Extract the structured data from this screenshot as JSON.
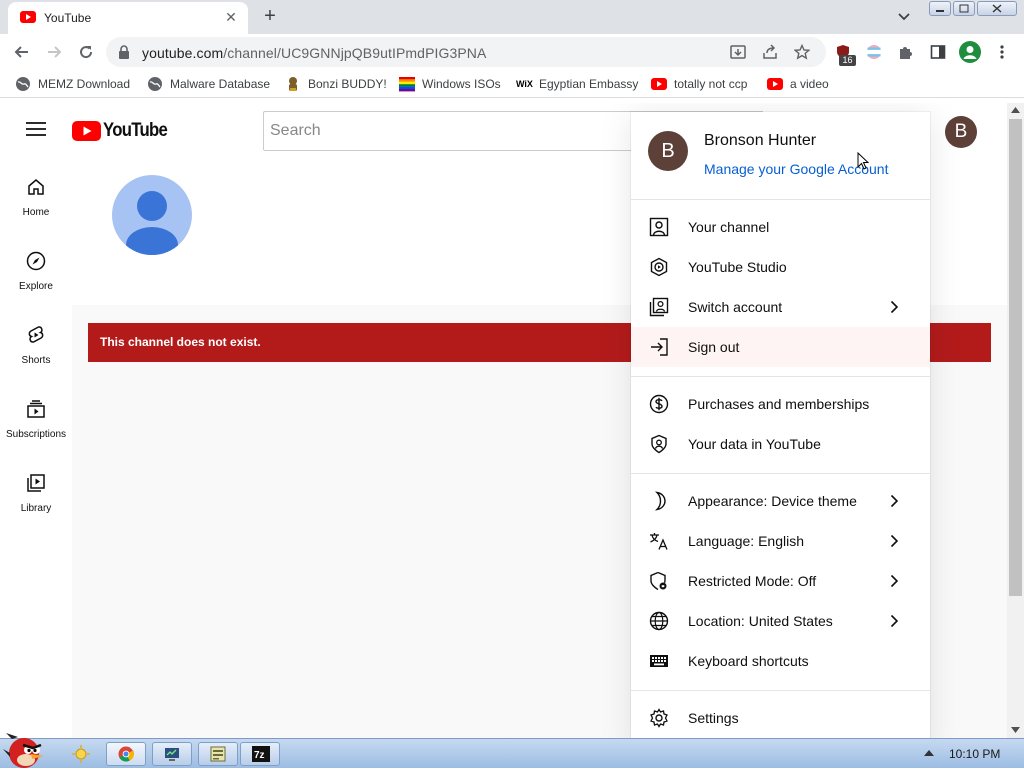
{
  "browser": {
    "tab_title": "YouTube",
    "url_host": "youtube.com",
    "url_path": "/channel/UC9GNNjpQB9utIPmdPIG3PNA",
    "extension_badge": "16"
  },
  "bookmarks": [
    {
      "label": "MEMZ Download",
      "icon": "globe-icon"
    },
    {
      "label": "Malware Database",
      "icon": "globe-icon"
    },
    {
      "label": "Bonzi BUDDY!",
      "icon": "bonzi-icon"
    },
    {
      "label": "Windows ISOs",
      "icon": "windows-flag-icon"
    },
    {
      "label": "Egyptian Embassy",
      "icon": "wix-icon"
    },
    {
      "label": "totally not ccp",
      "icon": "youtube-icon"
    },
    {
      "label": "a video",
      "icon": "youtube-icon"
    }
  ],
  "youtube": {
    "logo_text": "YouTube",
    "search_placeholder": "Search",
    "avatar_letter": "B",
    "guide": [
      {
        "label": "Home",
        "icon": "home-icon"
      },
      {
        "label": "Explore",
        "icon": "compass-icon"
      },
      {
        "label": "Shorts",
        "icon": "shorts-icon"
      },
      {
        "label": "Subscriptions",
        "icon": "subscriptions-icon"
      },
      {
        "label": "Library",
        "icon": "library-icon"
      }
    ],
    "error_message": "This channel does not exist."
  },
  "account_menu": {
    "name": "Bronson Hunter",
    "manage_link": "Manage your Google Account",
    "items": [
      {
        "label": "Your channel",
        "icon": "person-icon"
      },
      {
        "label": "YouTube Studio",
        "icon": "studio-icon"
      },
      {
        "label": "Switch account",
        "icon": "switch-account-icon"
      },
      {
        "label": "Sign out",
        "icon": "sign-out-icon"
      },
      {
        "label": "Purchases and memberships",
        "icon": "dollar-icon"
      },
      {
        "label": "Your data in YouTube",
        "icon": "shield-person-icon"
      },
      {
        "label": "Appearance: Device theme",
        "icon": "moon-icon"
      },
      {
        "label": "Language: English",
        "icon": "translate-icon"
      },
      {
        "label": "Restricted Mode: Off",
        "icon": "restricted-icon"
      },
      {
        "label": "Location: United States",
        "icon": "globe-icon"
      },
      {
        "label": "Keyboard shortcuts",
        "icon": "keyboard-icon"
      },
      {
        "label": "Settings",
        "icon": "gear-icon"
      }
    ]
  },
  "taskbar": {
    "clock": "10:10 PM"
  },
  "colors": {
    "youtube_red": "#ff0000",
    "error_banner": "#b31b1b",
    "link_blue": "#065fd4",
    "avatar_brown": "#5d4037"
  }
}
